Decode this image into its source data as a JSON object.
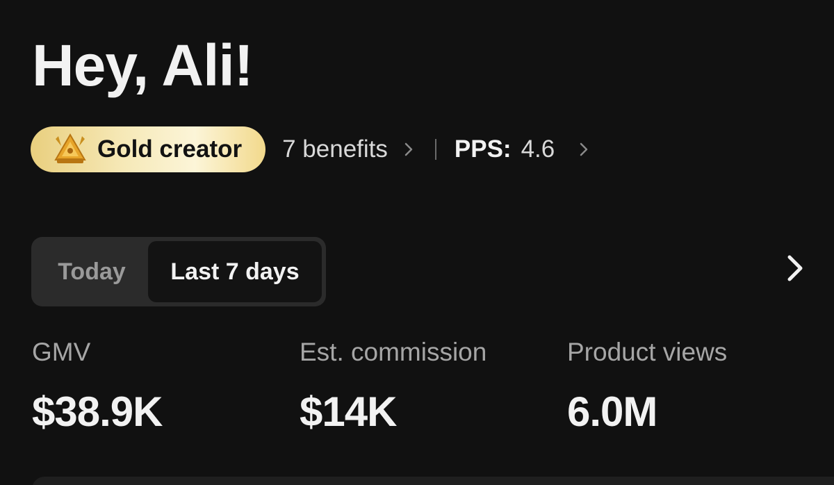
{
  "header": {
    "greeting": "Hey, Ali!"
  },
  "status": {
    "tier_label": "Gold creator",
    "tier_icon": "gold-crown-badge-icon",
    "benefits_label": "7 benefits",
    "pps_label": "PPS:",
    "pps_value": "4.6"
  },
  "period_tabs": {
    "tabs": [
      {
        "label": "Today",
        "selected": false
      },
      {
        "label": "Last 7 days",
        "selected": true
      }
    ]
  },
  "metrics": [
    {
      "label": "GMV",
      "value": "$38.9K"
    },
    {
      "label": "Est. commission",
      "value": "$14K"
    },
    {
      "label": "Product views",
      "value": "6.0M"
    }
  ],
  "colors": {
    "background": "#111111",
    "gold_badge": "#f6e9b8",
    "segment_bg": "#2b2b2b",
    "segment_active": "#131313"
  }
}
